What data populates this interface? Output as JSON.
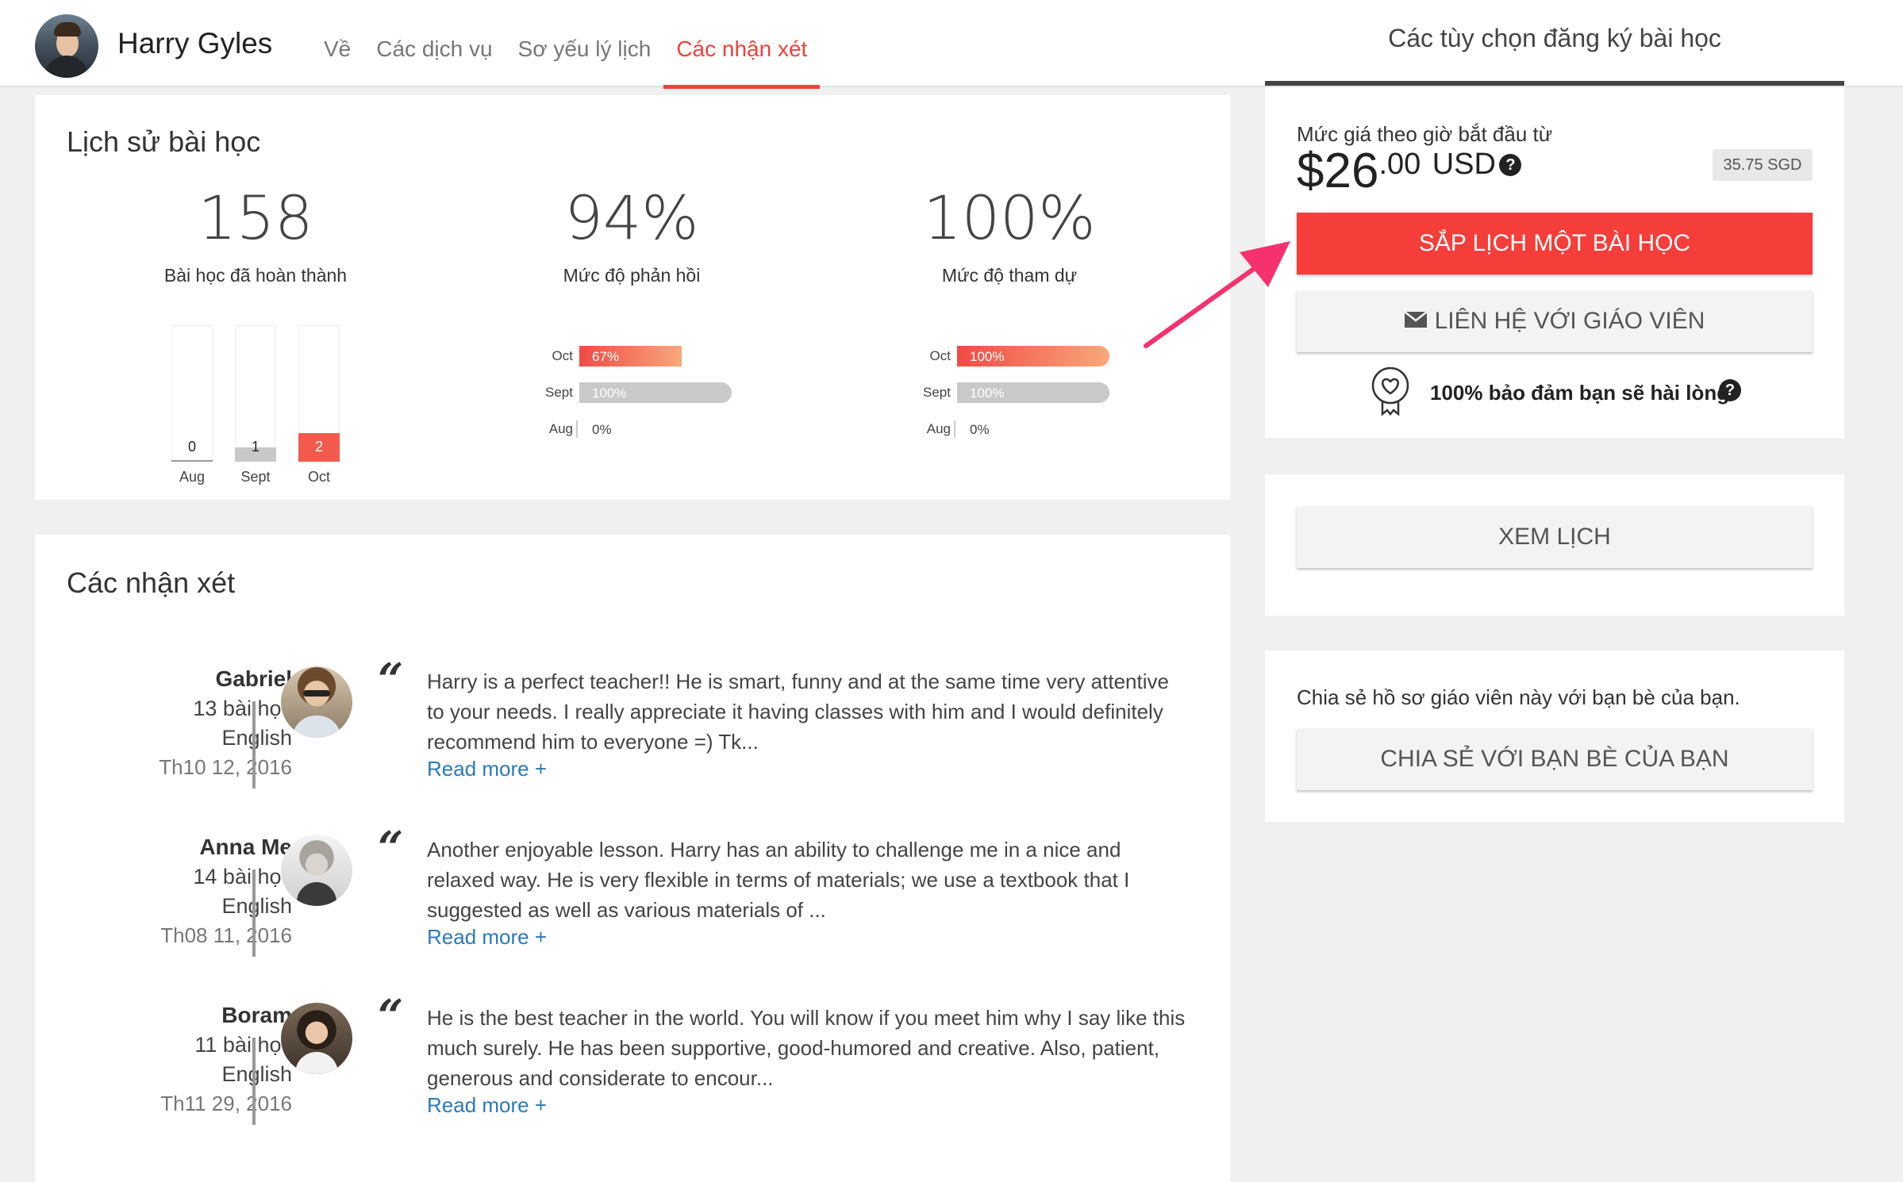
{
  "header": {
    "teacher_name": "Harry Gyles",
    "nav": [
      {
        "label": "Về"
      },
      {
        "label": "Các dịch vụ"
      },
      {
        "label": "Sơ yếu lý lịch"
      },
      {
        "label": "Các nhận xét"
      }
    ],
    "active_tab": "Các nhận xét",
    "right_title": "Các tùy chọn đăng ký bài học"
  },
  "history": {
    "title": "Lịch sử bài học",
    "stats": [
      {
        "value": "158",
        "label": "Bài học đã hoàn thành"
      },
      {
        "value": "94%",
        "label": "Mức độ phản hồi"
      },
      {
        "value": "100%",
        "label": "Mức độ tham dự"
      }
    ],
    "lessons_chart": [
      {
        "month": "Aug",
        "value": "0",
        "level": 0
      },
      {
        "month": "Sept",
        "value": "1",
        "level": 0.5
      },
      {
        "month": "Oct",
        "value": "2",
        "level": 1.0
      }
    ],
    "response_chart": [
      {
        "month": "Oct",
        "value": "67%",
        "level": 0.67
      },
      {
        "month": "Sept",
        "value": "100%",
        "level": 1.0
      },
      {
        "month": "Aug",
        "value": "0%",
        "level": 0
      }
    ],
    "attendance_chart": [
      {
        "month": "Oct",
        "value": "100%",
        "level": 1.0
      },
      {
        "month": "Sept",
        "value": "100%",
        "level": 1.0
      },
      {
        "month": "Aug",
        "value": "0%",
        "level": 0
      }
    ]
  },
  "reviews": {
    "title": "Các nhận xét",
    "read_more": "Read more +",
    "items": [
      {
        "name": "Gabriel",
        "lessons": "13 bài học",
        "language": "English",
        "date": "Th10 12, 2016",
        "text": "Harry is a perfect teacher!! He is smart, funny and at the same time very attentive to your needs. I really appreciate it having classes with him and I would definitely recommend him to everyone =) Tk..."
      },
      {
        "name": "Anna Me",
        "lessons": "14 bài học",
        "language": "English",
        "date": "Th08 11, 2016",
        "text": "Another enjoyable lesson. Harry has an ability to challenge me in a nice and relaxed way. He is very flexible in terms of materials; we use a textbook that I suggested as well as various materials of ..."
      },
      {
        "name": "Boram",
        "lessons": "11 bài học",
        "language": "English",
        "date": "Th11 29, 2016",
        "text": "He is the best teacher in the world. You will know if you meet him why I say like this much surely. He has been supportive, good-humored and creative. Also, patient, generous and considerate to encour..."
      }
    ]
  },
  "booking": {
    "price_label": "Mức giá theo giờ bắt đầu từ",
    "price_main": "$26",
    "price_cents": ".00",
    "price_currency": "USD",
    "price_alt": "35.75 SGD",
    "schedule_button": "SẮP LỊCH MỘT BÀI HỌC",
    "contact_button": "LIÊN HỆ VỚI GIÁO VIÊN",
    "guarantee": "100% bảo đảm bạn sẽ hài lòng",
    "calendar_button": "XEM LỊCH",
    "share_text": "Chia sẻ hồ sơ giáo viên này với bạn bè của bạn.",
    "share_button": "CHIA SẺ VỚI BẠN BÈ CỦA BẠN"
  },
  "colors": {
    "accent": "#f0413b",
    "primary_button": "#f53d3a",
    "arrow": "#f5326e",
    "link": "#2a7ab8"
  }
}
